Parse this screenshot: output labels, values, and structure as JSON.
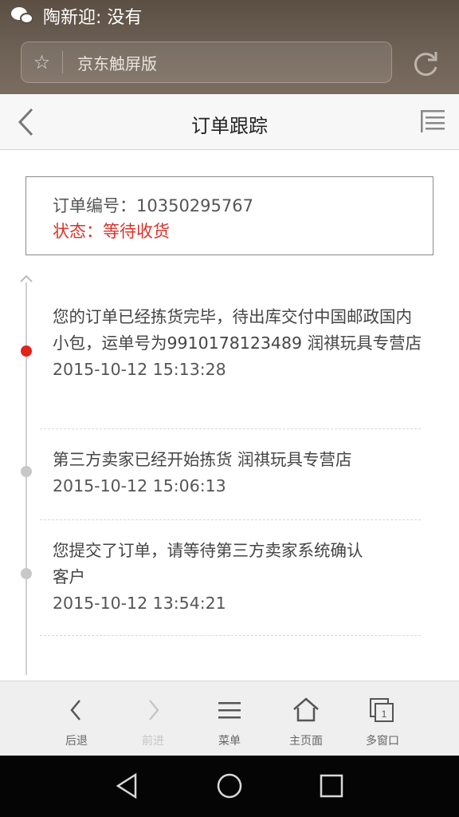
{
  "status_bar": {
    "notification_icon": "wechat-icon",
    "notification_text": "陶新迎: 没有"
  },
  "browser": {
    "url_text": "京东触屏版",
    "star_icon": "star-icon",
    "refresh_icon": "refresh-icon"
  },
  "header": {
    "title": "订单跟踪",
    "back_icon": "chevron-left-icon",
    "menu_icon": "list-menu-icon"
  },
  "order": {
    "number_line": "订单编号：10350295767",
    "status_line": "状态：等待收货"
  },
  "timeline": [
    {
      "text": "您的订单已经拣货完毕，待出库交付中国邮政国内小包，运单号为9910178123489  润祺玩具专营店",
      "time": "2015-10-12 15:13:28",
      "active": true
    },
    {
      "text": "第三方卖家已经开始拣货  润祺玩具专营店",
      "time": "2015-10-12 15:06:13",
      "active": false
    },
    {
      "text": "您提交了订单，请等待第三方卖家系统确认  客户",
      "time": "2015-10-12 13:54:21",
      "active": false
    }
  ],
  "toolbar": {
    "back_label": "后退",
    "forward_label": "前进",
    "menu_label": "菜单",
    "home_label": "主页面",
    "windows_label": "多窗口",
    "windows_count": "1"
  },
  "colors": {
    "accent_red": "#e2231a",
    "status_red": "#d9342b"
  }
}
